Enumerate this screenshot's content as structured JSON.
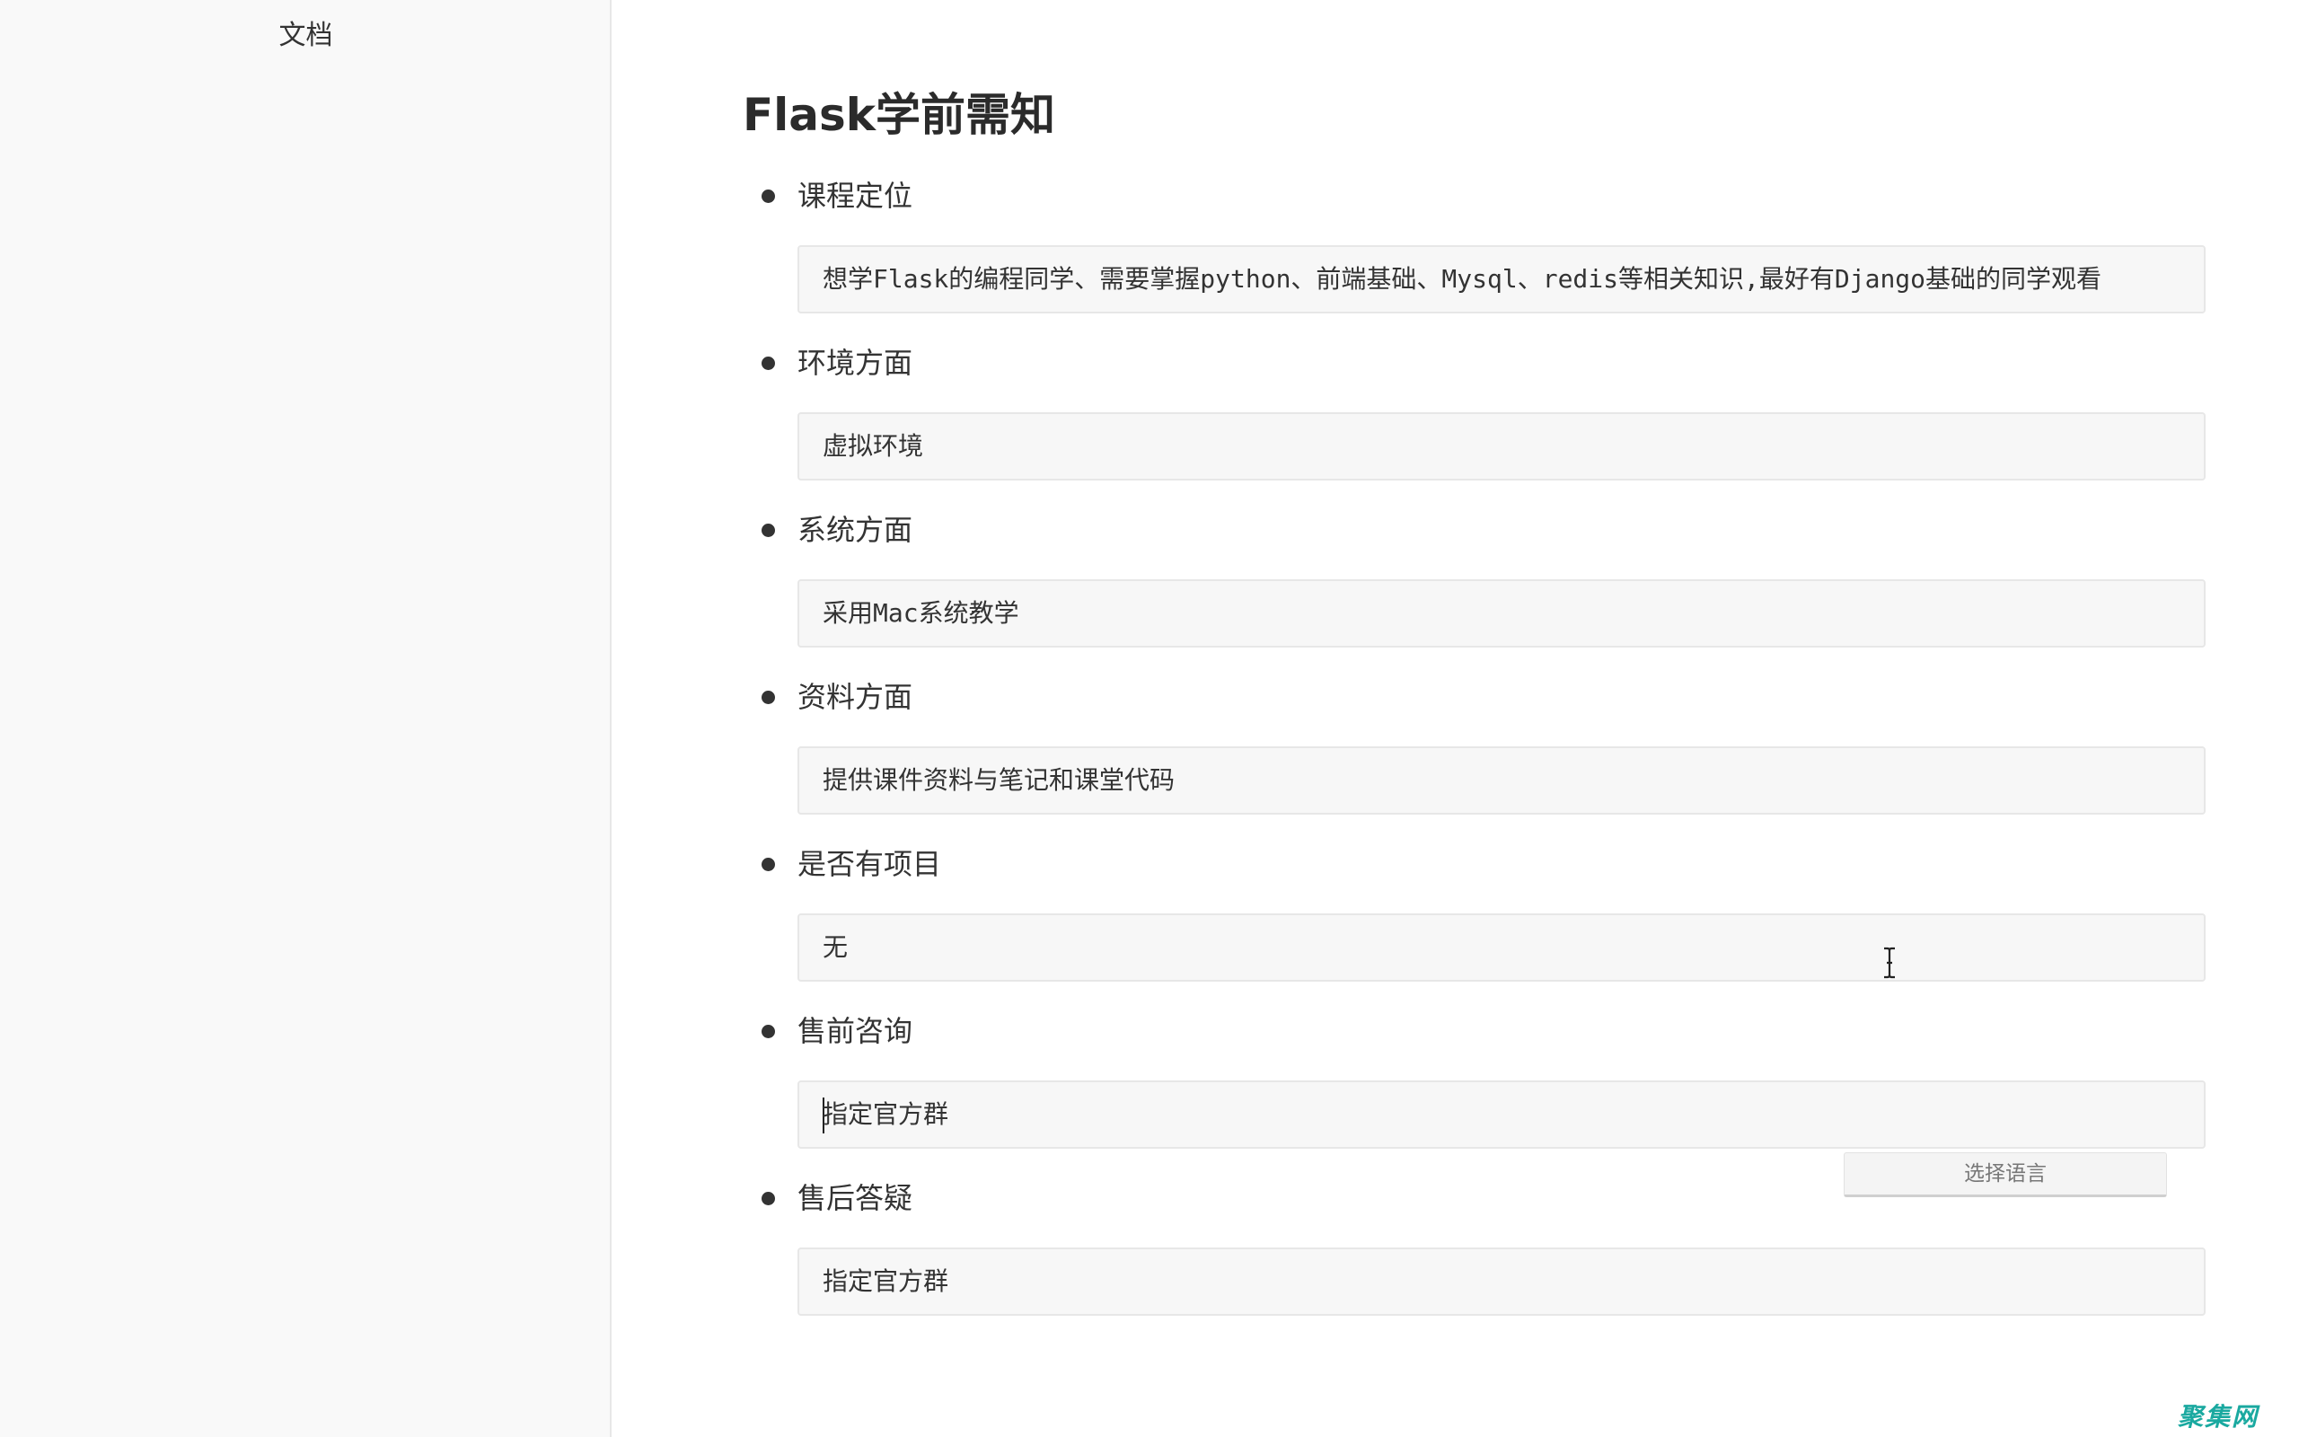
{
  "sidebar": {
    "title": "文档"
  },
  "page": {
    "title": "Flask学前需知"
  },
  "items": [
    {
      "label": "课程定位",
      "content": "想学Flask的编程同学、需要掌握python、前端基础、Mysql、redis等相关知识,最好有Django基础的同学观看"
    },
    {
      "label": "环境方面",
      "content": "虚拟环境"
    },
    {
      "label": "系统方面",
      "content": "采用Mac系统教学"
    },
    {
      "label": "资料方面",
      "content": "提供课件资料与笔记和课堂代码"
    },
    {
      "label": "是否有项目",
      "content": "无"
    },
    {
      "label": "售前咨询",
      "content": "指定官方群"
    },
    {
      "label": "售后答疑",
      "content": "指定官方群"
    }
  ],
  "language_selector": {
    "label": "选择语言"
  },
  "watermark": {
    "text": "聚集网"
  },
  "colors": {
    "sidebar_bg": "#f9f9f9",
    "code_bg": "#f7f7f7",
    "watermark": "#1aa9a0"
  },
  "icons": {
    "cursor": "text-cursor-icon"
  }
}
